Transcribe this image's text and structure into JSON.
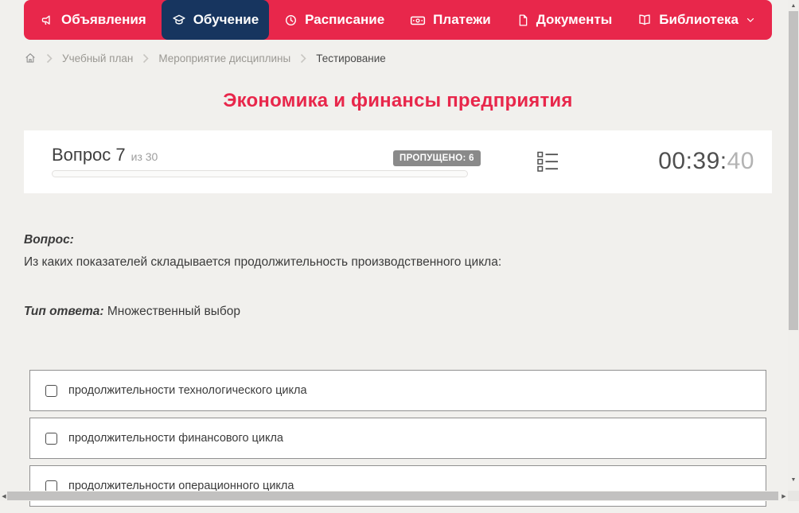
{
  "nav": {
    "items": [
      {
        "label": "Объявления",
        "icon": "megaphone-icon",
        "active": false
      },
      {
        "label": "Обучение",
        "icon": "graduation-cap-icon",
        "active": true
      },
      {
        "label": "Расписание",
        "icon": "clock-icon",
        "active": false
      },
      {
        "label": "Платежи",
        "icon": "banknote-icon",
        "active": false
      },
      {
        "label": "Документы",
        "icon": "document-icon",
        "active": false
      },
      {
        "label": "Библиотека",
        "icon": "book-icon",
        "active": false,
        "has_dropdown": true
      }
    ],
    "colors": {
      "bar": "#e8274b",
      "active_item": "#17355f"
    }
  },
  "breadcrumb": {
    "items": [
      {
        "label": "Учебный план",
        "current": false
      },
      {
        "label": "Мероприятие дисциплины",
        "current": false
      },
      {
        "label": "Тестирование",
        "current": true
      }
    ]
  },
  "page": {
    "title": "Экономика и финансы предприятия",
    "title_color": "#e8274b"
  },
  "question_panel": {
    "question_label": "Вопрос 7",
    "question_number": 7,
    "total_questions_label": "из 30",
    "total_questions": 30,
    "skipped_badge": "ПРОПУЩЕНО: 6",
    "skipped_count": 6,
    "badge_color": "#8a8a8a",
    "progress_percent": 0,
    "timer": {
      "value": "00:39:40",
      "main": "00:39:",
      "seconds": "40"
    }
  },
  "question": {
    "label": "Вопрос:",
    "text": "Из каких показателей складывается продолжительность производственного цикла:",
    "answer_type_label": "Тип ответа:",
    "answer_type": "Множественный выбор",
    "options": [
      {
        "label": "продолжительности технологического цикла",
        "checked": false
      },
      {
        "label": "продолжительности финансового цикла",
        "checked": false
      },
      {
        "label": "продолжительности операционного цикла",
        "checked": false
      }
    ]
  },
  "scroll": {
    "up_arrow": "▲",
    "down_arrow": "▼",
    "left_arrow": "◀",
    "right_arrow": "▶"
  }
}
